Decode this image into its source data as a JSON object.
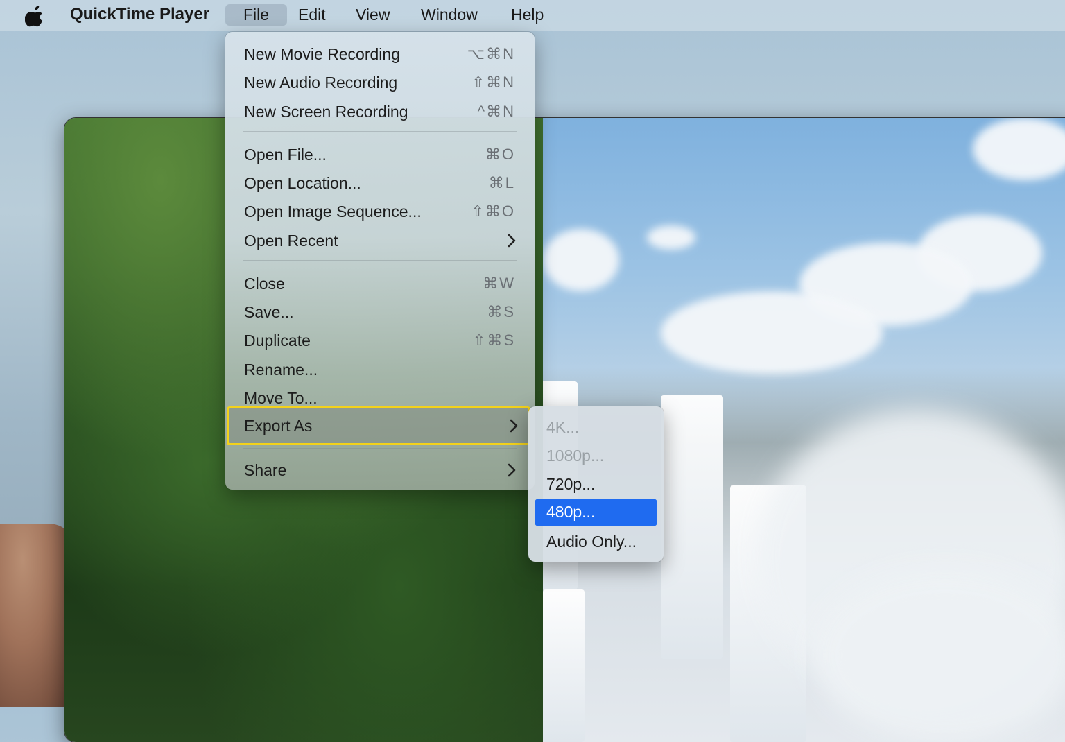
{
  "menubar": {
    "app_name": "QuickTime Player",
    "items": [
      {
        "label": "File",
        "active": true
      },
      {
        "label": "Edit"
      },
      {
        "label": "View"
      },
      {
        "label": "Window"
      },
      {
        "label": "Help"
      }
    ]
  },
  "file_menu": {
    "items": [
      {
        "label": "New Movie Recording",
        "shortcut": "⌥⌘N"
      },
      {
        "label": "New Audio Recording",
        "shortcut": "⇧⌘N"
      },
      {
        "label": "New Screen Recording",
        "shortcut": "^⌘N"
      },
      {
        "label": "Open File...",
        "shortcut": "⌘O"
      },
      {
        "label": "Open Location...",
        "shortcut": "⌘L"
      },
      {
        "label": "Open Image Sequence...",
        "shortcut": "⇧⌘O"
      },
      {
        "label": "Open Recent",
        "submenu": true
      },
      {
        "label": "Close",
        "shortcut": "⌘W"
      },
      {
        "label": "Save...",
        "shortcut": "⌘S"
      },
      {
        "label": "Duplicate",
        "shortcut": "⇧⌘S"
      },
      {
        "label": "Rename..."
      },
      {
        "label": "Move To..."
      },
      {
        "label": "Export As",
        "submenu": true,
        "highlighted": true
      },
      {
        "label": "Share",
        "submenu": true
      }
    ]
  },
  "export_submenu": {
    "items": [
      {
        "label": "4K...",
        "disabled": true
      },
      {
        "label": "1080p...",
        "disabled": true
      },
      {
        "label": "720p..."
      },
      {
        "label": "480p...",
        "selected": true
      },
      {
        "label": "Audio Only..."
      }
    ]
  },
  "colors": {
    "highlight_border": "#f3d21b",
    "selection_blue": "#1f6bf0"
  }
}
